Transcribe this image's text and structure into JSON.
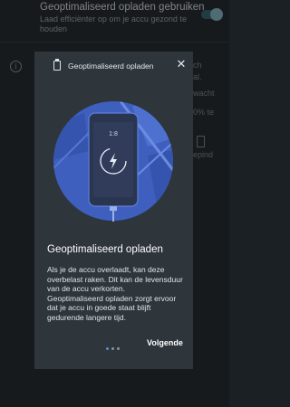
{
  "background": {
    "setting_title": "Geoptimaliseerd opladen gebruiken",
    "setting_subtitle": "Laad efficiënter op om je accu gezond te houden",
    "toggle_on": true,
    "fragments": [
      "ch",
      "al.",
      "wacht",
      "0% te",
      "epind"
    ]
  },
  "dialog": {
    "header_title": "Geoptimaliseerd opladen",
    "header_icon": "battery-icon",
    "close_icon": "close-icon",
    "phone_battery_label": "1:8",
    "heading": "Geoptimaliseerd opladen",
    "body": "Als je de accu overlaadt, kan deze overbelast raken. Dit kan de levensduur van de accu verkorten. Geoptimaliseerd opladen zorgt ervoor dat je accu in goede staat blijft gedurende langere tijd.",
    "page_indicator": {
      "pages": 3,
      "current": 1
    },
    "next_label": "Volgende",
    "accent_color": "#3f5fbf"
  }
}
